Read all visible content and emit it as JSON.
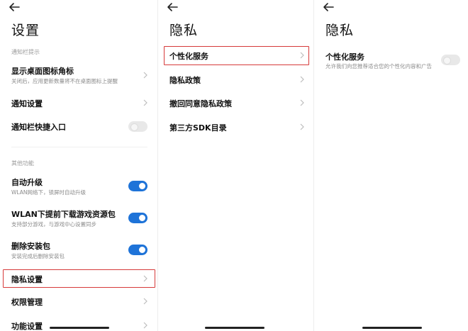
{
  "screens": [
    {
      "title": "设置",
      "sections": [
        {
          "header": "通知栏提示"
        },
        {
          "header": "其他功能"
        }
      ],
      "items": [
        {
          "label": "显示桌面图标角标",
          "sub": "关闭后，应用更新数量将不在桌面图标上提醒",
          "control": "chevron"
        },
        {
          "label": "通知设置",
          "sub": "",
          "control": "chevron"
        },
        {
          "label": "通知栏快捷入口",
          "sub": "",
          "control": "toggle",
          "on": false
        },
        {
          "label": "自动升级",
          "sub": "WLAN网络下，锁屏时自动升级",
          "control": "toggle",
          "on": true
        },
        {
          "label": "WLAN下提前下载游戏资源包",
          "sub": "支持部分游戏，与游戏中心设置同步",
          "control": "toggle",
          "on": true
        },
        {
          "label": "删除安装包",
          "sub": "安装完成后删除安装包",
          "control": "toggle",
          "on": true
        },
        {
          "label": "隐私设置",
          "sub": "",
          "control": "chevron",
          "highlighted": true
        },
        {
          "label": "权限管理",
          "sub": "",
          "control": "chevron"
        },
        {
          "label": "功能设置",
          "sub": "",
          "control": "chevron"
        }
      ]
    },
    {
      "title": "隐私",
      "items": [
        {
          "label": "个性化服务",
          "control": "chevron",
          "highlighted": true
        },
        {
          "label": "隐私政策",
          "control": "chevron"
        },
        {
          "label": "撤回同意隐私政策",
          "control": "chevron"
        },
        {
          "label": "第三方SDK目录",
          "control": "chevron"
        }
      ]
    },
    {
      "title": "隐私",
      "items": [
        {
          "label": "个性化服务",
          "sub": "允许我们向您推荐适合您的个性化内容和广告",
          "control": "toggle",
          "on": false
        }
      ]
    }
  ],
  "colors": {
    "accent": "#1e73d8",
    "highlight": "#d63a3a",
    "toggle_off": "#e8e8e8"
  },
  "icons": {
    "back": "arrow-left-icon",
    "chevron": "chevron-right-icon"
  }
}
